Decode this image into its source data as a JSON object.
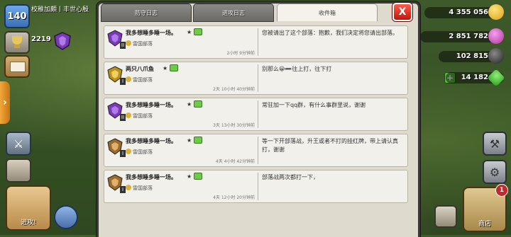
{
  "player": {
    "level": "140",
    "name": "校稚加頗丨丰世心殷",
    "trophies": "2219"
  },
  "resources": {
    "gold": "4 355 056",
    "elixir": "2 851 782",
    "dark_elixir": "102 815",
    "gems": "14 182"
  },
  "hud": {
    "attack_label": "进攻!",
    "shop_label": "商店",
    "shop_badge": "1",
    "side_tab": "›",
    "gem_plus": "+"
  },
  "tabs": [
    {
      "label": "防守日志",
      "active": false
    },
    {
      "label": "进攻日志",
      "active": false
    },
    {
      "label": "收件箱",
      "active": true
    }
  ],
  "close_label": "X",
  "messages": [
    {
      "sender": "我多想睡多睡一场。",
      "clan": "雷国部落",
      "time": "2小时 9分钟前",
      "text": "您被请出了这个部落：抱歉，我们决定将您请出部落。",
      "badge": "purple",
      "rank": "II"
    },
    {
      "sender": "两只八爪鱼",
      "clan": "雷国部落",
      "time": "2天 10小时 40分钟前",
      "text": "别那么😀➖往上打，往下打",
      "badge": "gold",
      "rank": "I"
    },
    {
      "sender": "我多想睡多睡一场。",
      "clan": "雷国部落",
      "time": "3天 13小时 30分钟前",
      "text": "常驻加一下qq群，有什么事群里说，谢谢",
      "badge": "purple",
      "rank": "II"
    },
    {
      "sender": "我多想睡多睡一场。",
      "clan": "雷国部落",
      "time": "4天 4小时 42分钟前",
      "text": "等一下开部落战，升王或者不打的挂红牌，带上请认真打，谢谢",
      "badge": "bronze",
      "rank": "I"
    },
    {
      "sender": "我多想睡多睡一场。",
      "clan": "雷国部落",
      "time": "4天 12小时 20分钟前",
      "text": "部落战两次都打一下，",
      "badge": "bronze",
      "rank": "I"
    }
  ],
  "colors": {
    "panel_bg": "#dedacd",
    "message_bg": "#f2f0ea",
    "close": "#e0281a"
  }
}
